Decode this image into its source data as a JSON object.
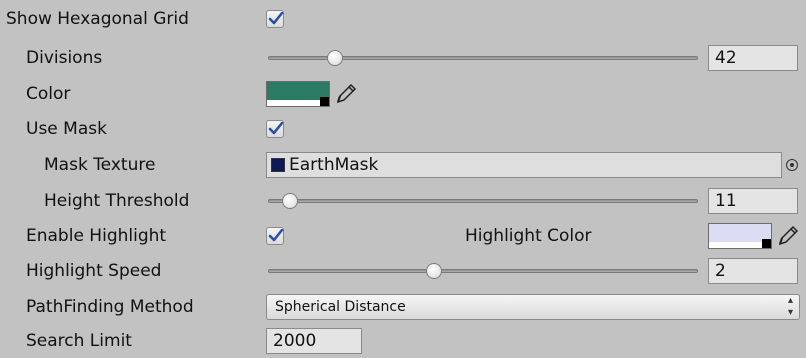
{
  "show_hex_grid": {
    "label": "Show Hexagonal Grid",
    "checked": true
  },
  "divisions": {
    "label": "Divisions",
    "value": "42",
    "slider_fraction": 0.1
  },
  "color": {
    "label": "Color",
    "swatch": "#2a7a64"
  },
  "use_mask": {
    "label": "Use Mask",
    "checked": true
  },
  "mask_texture": {
    "label": "Mask Texture",
    "value": "EarthMask"
  },
  "height_threshold": {
    "label": "Height Threshold",
    "value": "11",
    "slider_fraction": 0.04
  },
  "enable_highlight": {
    "label": "Enable Highlight",
    "checked": true
  },
  "highlight_color": {
    "label": "Highlight Color",
    "swatch": "#dcdcf4"
  },
  "highlight_speed": {
    "label": "Highlight Speed",
    "value": "2",
    "slider_fraction": 0.4
  },
  "pathfinding": {
    "label": "PathFinding Method",
    "value": "Spherical Distance"
  },
  "search_limit": {
    "label": "Search Limit",
    "value": "2000"
  }
}
